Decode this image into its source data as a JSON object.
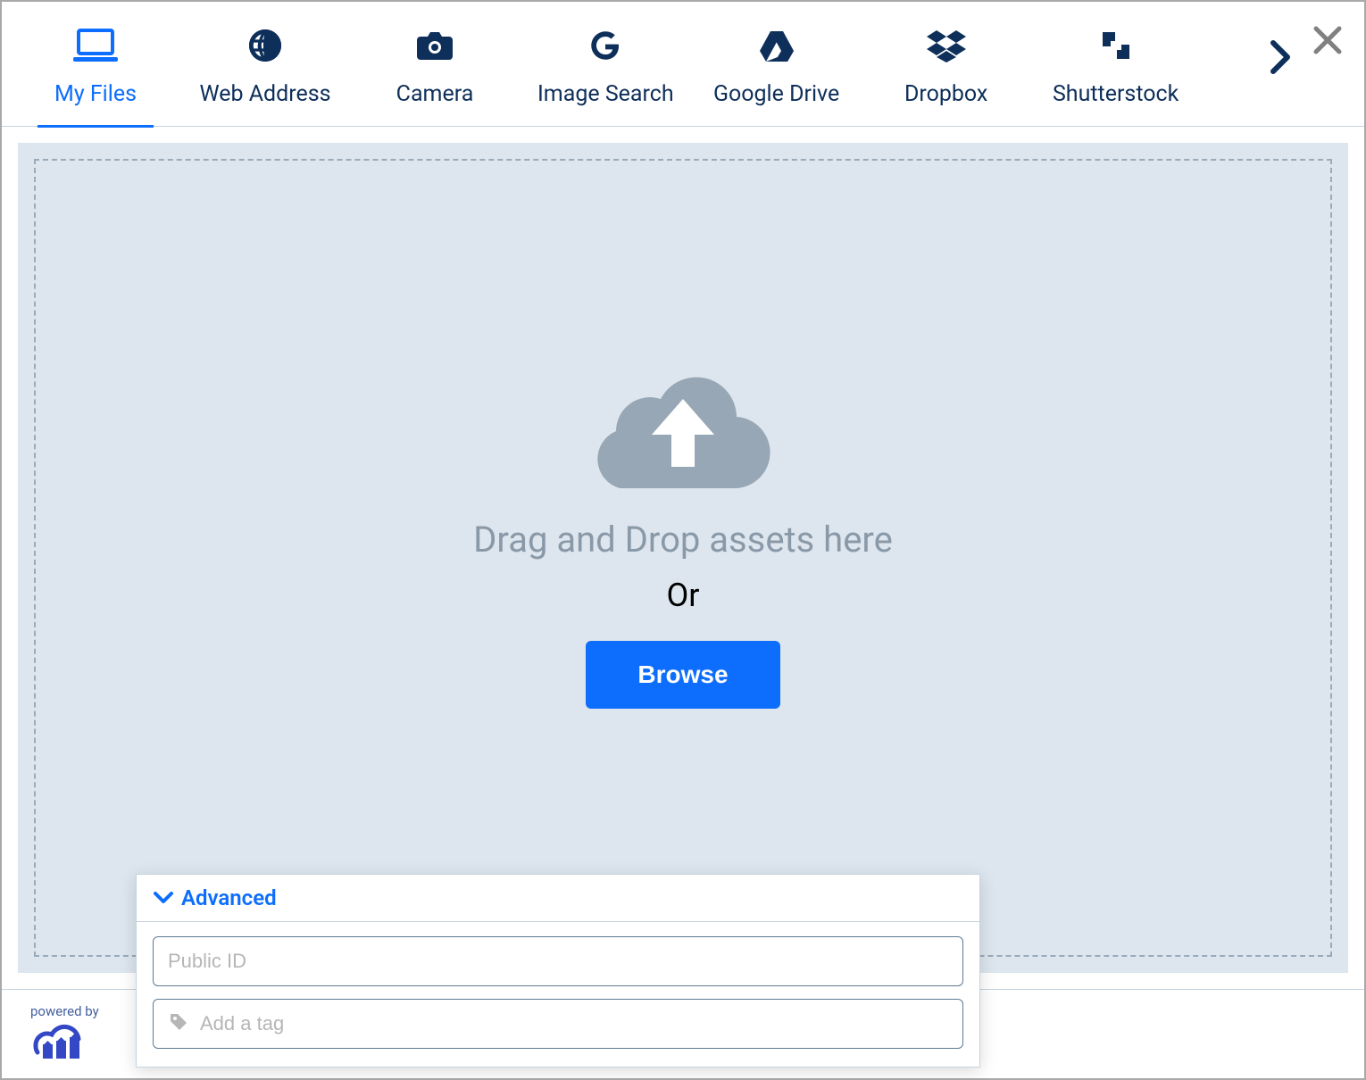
{
  "tabs": [
    {
      "label": "My Files",
      "icon": "laptop-icon",
      "active": true
    },
    {
      "label": "Web Address",
      "icon": "globe-icon",
      "active": false
    },
    {
      "label": "Camera",
      "icon": "camera-icon",
      "active": false
    },
    {
      "label": "Image Search",
      "icon": "google-icon",
      "active": false
    },
    {
      "label": "Google Drive",
      "icon": "google-drive-icon",
      "active": false
    },
    {
      "label": "Dropbox",
      "icon": "dropbox-icon",
      "active": false
    },
    {
      "label": "Shutterstock",
      "icon": "shutterstock-icon",
      "active": false
    }
  ],
  "drop_zone": {
    "drag_text": "Drag and Drop assets here",
    "or_text": "Or",
    "browse_label": "Browse"
  },
  "advanced": {
    "title": "Advanced",
    "public_id_placeholder": "Public ID",
    "tag_placeholder": "Add a tag"
  },
  "footer": {
    "powered_by": "powered by"
  },
  "colors": {
    "accent": "#0d6efd",
    "dark_navy": "#0e2f5a",
    "panel_bg": "#dde6ee"
  }
}
